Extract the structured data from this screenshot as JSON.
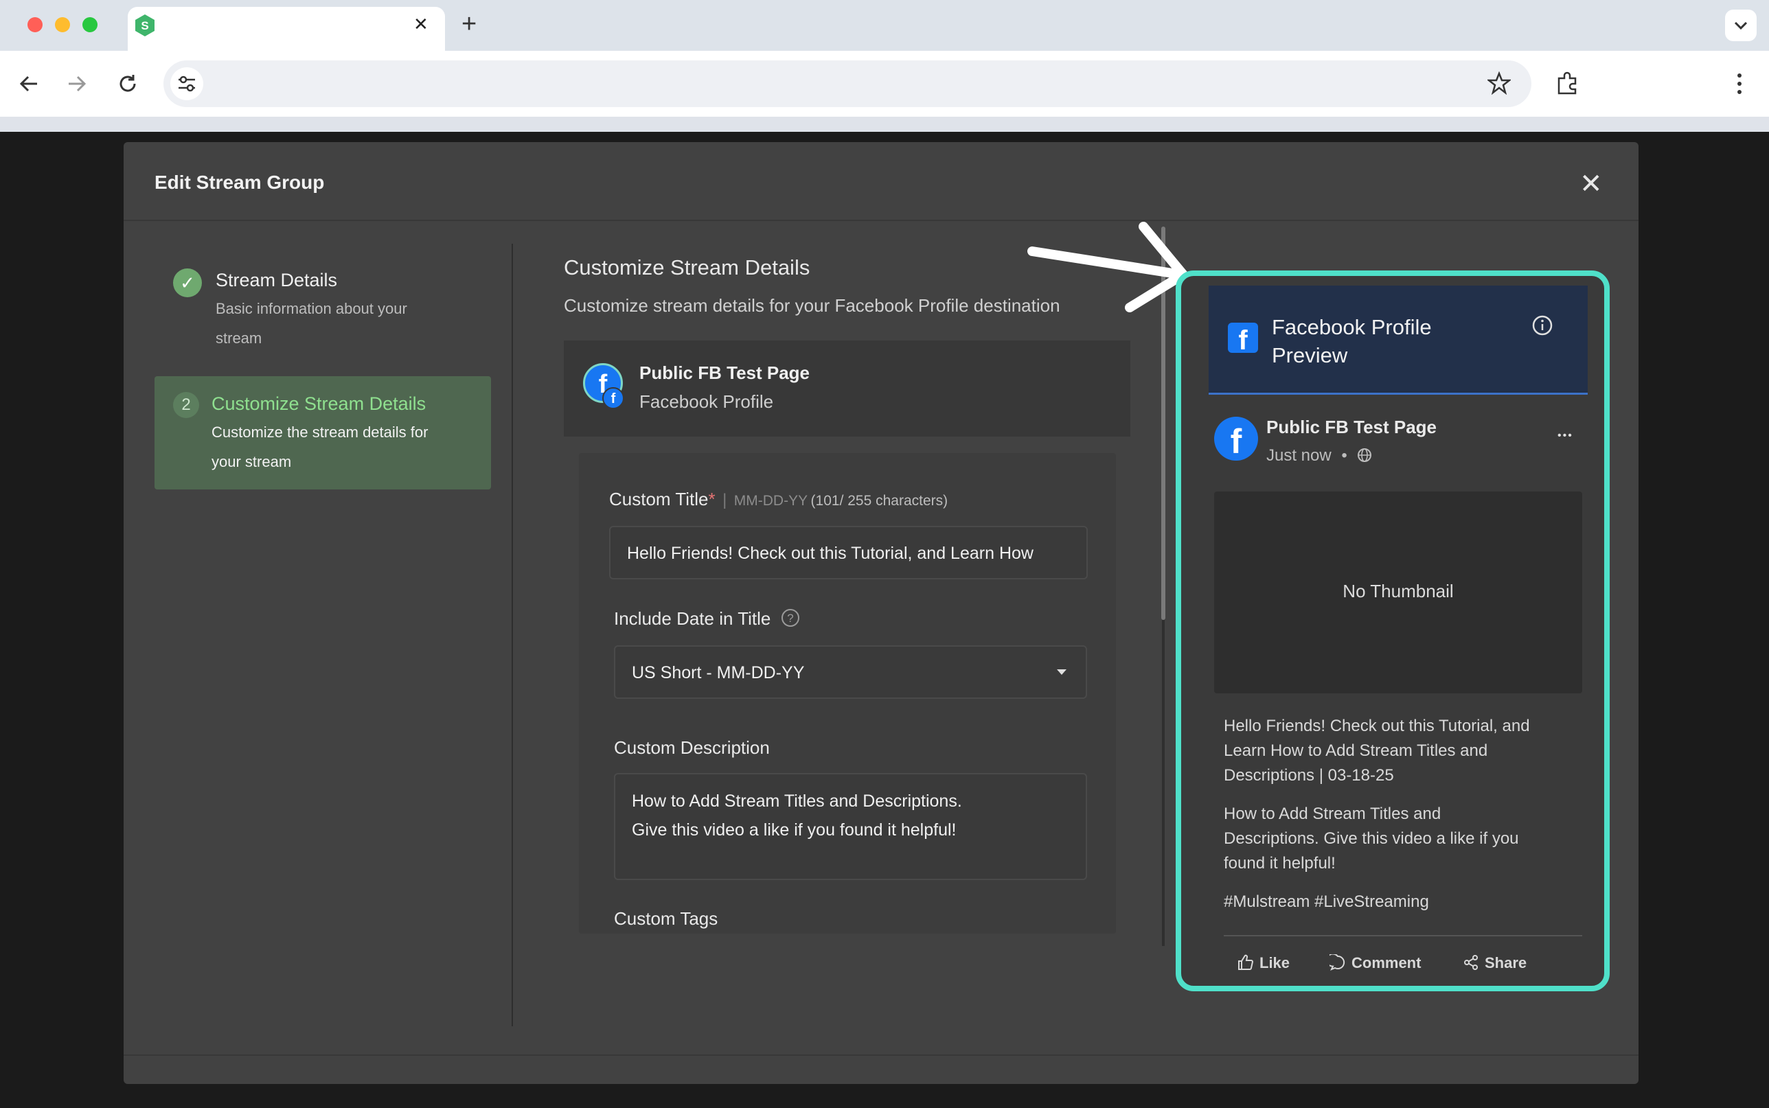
{
  "browser": {
    "new_tab_glyph": "+",
    "close_tab_glyph": "✕",
    "icons": [
      "back-arrow-icon",
      "forward-arrow-icon",
      "reload-icon",
      "site-settings-icon",
      "bookmark-star-icon",
      "extensions-icon",
      "menu-kebab-icon",
      "tab-dropdown-icon"
    ]
  },
  "modal": {
    "title": "Edit Stream Group",
    "close_glyph": "✕"
  },
  "stepper": {
    "steps": [
      {
        "number": "✓",
        "title": "Stream Details",
        "subtitle_line1": "Basic information about your",
        "subtitle_line2": "stream",
        "state": "completed"
      },
      {
        "number": "2",
        "title": "Customize Stream Details",
        "subtitle_line1": "Customize the stream details for",
        "subtitle_line2": "your stream",
        "state": "active"
      }
    ]
  },
  "customize": {
    "heading": "Customize Stream Details",
    "subheading": "Customize stream details for your Facebook Profile destination",
    "destination": {
      "name": "Public FB Test Page",
      "type": "Facebook Profile"
    },
    "custom_title": {
      "label": "Custom Title",
      "required_mark": "*",
      "separator": "|",
      "hint_format": "MM-DD-YY",
      "hint_count": "(101/ 255 characters)",
      "value": "Hello Friends! Check out this Tutorial, and Learn How"
    },
    "include_date": {
      "label": "Include Date in Title",
      "selected": "US Short - MM-DD-YY"
    },
    "custom_description": {
      "label": "Custom Description",
      "line1": "How to Add Stream Titles and Descriptions.",
      "line2": "Give this video a like if you found it helpful!"
    },
    "custom_tags": {
      "label": "Custom Tags"
    }
  },
  "preview": {
    "header_line1": "Facebook Profile",
    "header_line2": "Preview",
    "page_name": "Public FB Test Page",
    "time": "Just now",
    "dot": "•",
    "more_glyph": "•••",
    "thumbnail_text": "No Thumbnail",
    "title_line1": "Hello Friends! Check out this Tutorial, and",
    "title_line2": "Learn How to Add Stream Titles and",
    "title_line3": "Descriptions | 03-18-25",
    "desc_line1": "How to Add Stream Titles and",
    "desc_line2": "Descriptions. Give this video a like if you",
    "desc_line3": "found it helpful!",
    "tags": "#Mulstream #LiveStreaming",
    "actions": {
      "like": "Like",
      "comment": "Comment",
      "share": "Share"
    }
  },
  "colors": {
    "highlight": "#4fe0c9",
    "active_step_bg": "#4f6750",
    "active_step_text": "#8fe08f",
    "facebook_blue": "#1877f2",
    "preview_header": "#22304a",
    "required": "#e57373"
  }
}
